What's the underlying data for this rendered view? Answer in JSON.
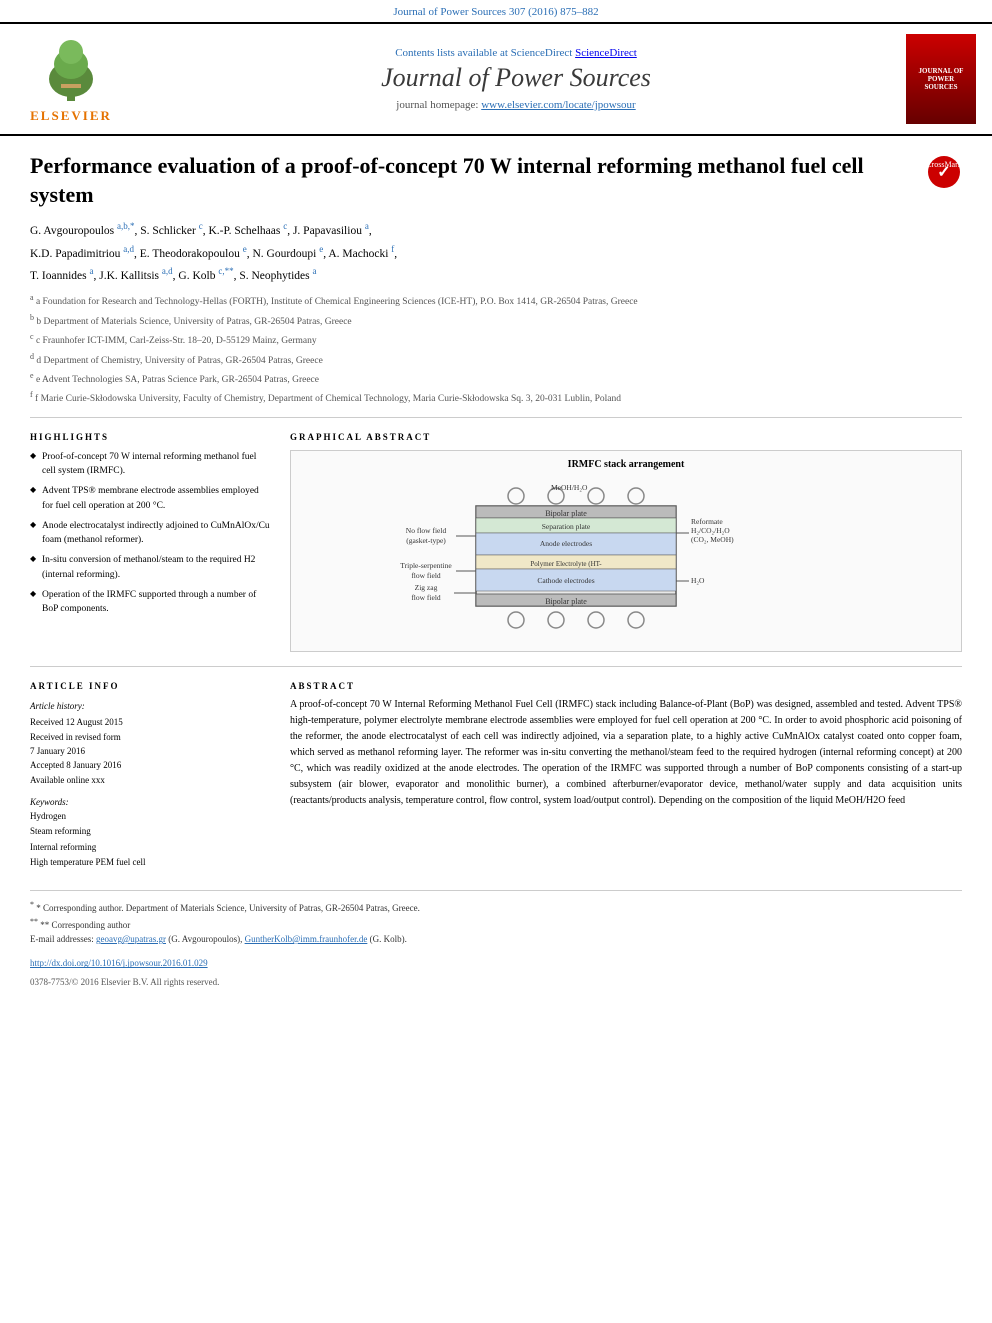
{
  "journal_link": "Journal of Power Sources 307 (2016) 875–882",
  "sciencedirect_text": "Contents lists available at ScienceDirect",
  "journal_title": "Journal of Power Sources",
  "journal_homepage_label": "journal homepage:",
  "journal_homepage_url": "www.elsevier.com/locate/jpowsour",
  "elsevier_brand": "ELSEVIER",
  "paper_title": "Performance evaluation of a proof-of-concept 70 W internal reforming methanol fuel cell system",
  "authors_line1": "G. Avgouropoulos a,b,*, S. Schlicker c, K.-P. Schelhaas c, J. Papavasiliou a,",
  "authors_line2": "K.D. Papadimitriou a,d, E. Theodorakopoulou e, N. Gourdoupi e, A. Machocki f,",
  "authors_line3": "T. Ioannides a, J.K. Kallitsis a,d, G. Kolb c,**, S. Neophytides a",
  "affiliations": [
    "a Foundation for Research and Technology-Hellas (FORTH), Institute of Chemical Engineering Sciences (ICE-HT), P.O. Box 1414, GR-26504 Patras, Greece",
    "b Department of Materials Science, University of Patras, GR-26504 Patras, Greece",
    "c Fraunhofer ICT-IMM, Carl-Zeiss-Str. 18–20, D-55129 Mainz, Germany",
    "d Department of Chemistry, University of Patras, GR-26504 Patras, Greece",
    "e Advent Technologies SA, Patras Science Park, GR-26504 Patras, Greece",
    "f Marie Curie-Skłodowska University, Faculty of Chemistry, Department of Chemical Technology, Maria Curie-Skłodowska Sq. 3, 20-031 Lublin, Poland"
  ],
  "highlights_label": "HIGHLIGHTS",
  "highlights": [
    "Proof-of-concept 70 W internal reforming methanol fuel cell system (IRMFC).",
    "Advent TPS® membrane electrode assemblies employed for fuel cell operation at 200 °C.",
    "Anode electrocatalyst indirectly adjoined to CuMnAlOx/Cu foam (methanol reformer).",
    "In-situ conversion of methanol/steam to the required H2 (internal reforming).",
    "Operation of the IRMFC supported through a number of BoP components."
  ],
  "graphical_abstract_label": "GRAPHICAL ABSTRACT",
  "graphical_abstract_title": "IRMFC stack arrangement",
  "article_info_label": "ARTICLE INFO",
  "article_history_label": "Article history:",
  "received_1": "Received 12 August 2015",
  "received_revised": "Received in revised form",
  "received_revised_date": "7 January 2016",
  "accepted": "Accepted 8 January 2016",
  "available": "Available online xxx",
  "keywords_label": "Keywords:",
  "keywords": [
    "Hydrogen",
    "Steam reforming",
    "Internal reforming",
    "High temperature PEM fuel cell"
  ],
  "abstract_label": "ABSTRACT",
  "abstract_text": "A proof-of-concept 70 W Internal Reforming Methanol Fuel Cell (IRMFC) stack including Balance-of-Plant (BoP) was designed, assembled and tested. Advent TPS® high-temperature, polymer electrolyte membrane electrode assemblies were employed for fuel cell operation at 200 °C. In order to avoid phosphoric acid poisoning of the reformer, the anode electrocatalyst of each cell was indirectly adjoined, via a separation plate, to a highly active CuMnAlOx catalyst coated onto copper foam, which served as methanol reforming layer. The reformer was in-situ converting the methanol/steam feed to the required hydrogen (internal reforming concept) at 200 °C, which was readily oxidized at the anode electrodes. The operation of the IRMFC was supported through a number of BoP components consisting of a start-up subsystem (air blower, evaporator and monolithic burner), a combined afterburner/evaporator device, methanol/water supply and data acquisition units (reactants/products analysis, temperature control, flow control, system load/output control). Depending on the composition of the liquid MeOH/H2O feed",
  "footnote_corresponding_1": "* Corresponding author. Department of Materials Science, University of Patras, GR-26504 Patras, Greece.",
  "footnote_corresponding_2": "** Corresponding author",
  "footnote_email_label": "E-mail addresses:",
  "footnote_email_1": "geoavg@upatras.gr",
  "footnote_email_1_name": "(G. Avgouropoulos),",
  "footnote_email_2": "GuntherKolb@imm.fraunhofer.de",
  "footnote_email_2_name": "(G. Kolb).",
  "doi": "http://dx.doi.org/10.1016/j.jpowsour.2016.01.029",
  "copyright": "0378-7753/© 2016 Elsevier B.V. All rights reserved."
}
